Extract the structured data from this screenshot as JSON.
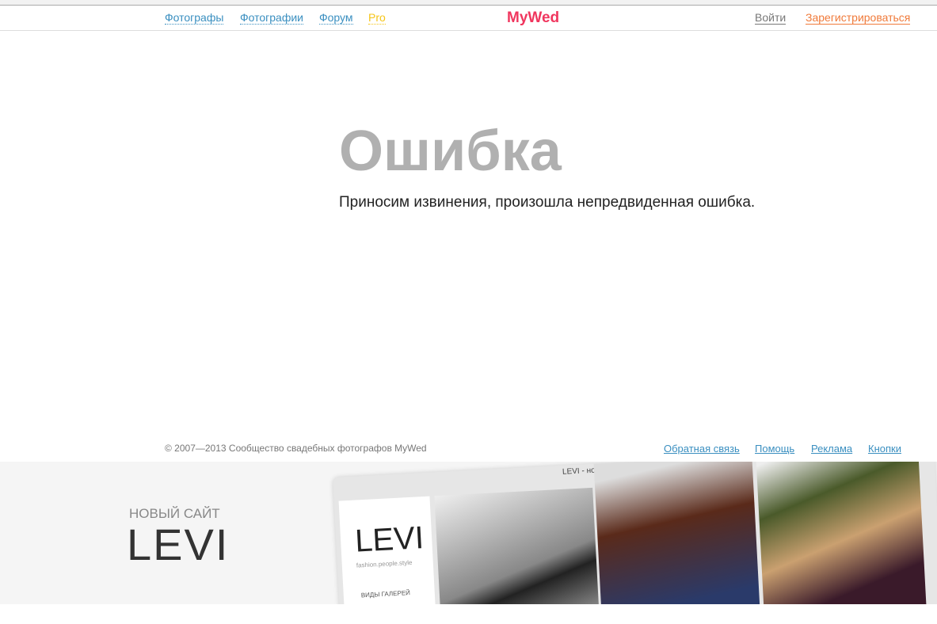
{
  "nav": {
    "items": [
      {
        "label": "Фотографы",
        "color": "#3a8fc0"
      },
      {
        "label": "Фотографии",
        "color": "#3a8fc0"
      },
      {
        "label": "Форум",
        "color": "#3a8fc0"
      },
      {
        "label": "Pro",
        "color": "#f5c518"
      }
    ],
    "logo": "MyWed",
    "login": "Войти",
    "register": "Зарегистрироваться"
  },
  "main": {
    "title": "Ошибка",
    "message": "Приносим извинения, произошла непредвиденная ошибка."
  },
  "footer": {
    "copyright": "© 2007—2013 Сообщество свадебных фотографов MyWed",
    "links": [
      "Обратная связь",
      "Помощь",
      "Реклама",
      "Кнопки"
    ]
  },
  "banner": {
    "subtitle": "НОВЫЙ САЙТ",
    "title": "LEVI",
    "window_title": "LEVI - новый сайт от ...",
    "logo_text": "LEVI",
    "tagline": "fashion.people.style",
    "menu_item": "ВИДЫ ГАЛЕРЕЙ"
  }
}
